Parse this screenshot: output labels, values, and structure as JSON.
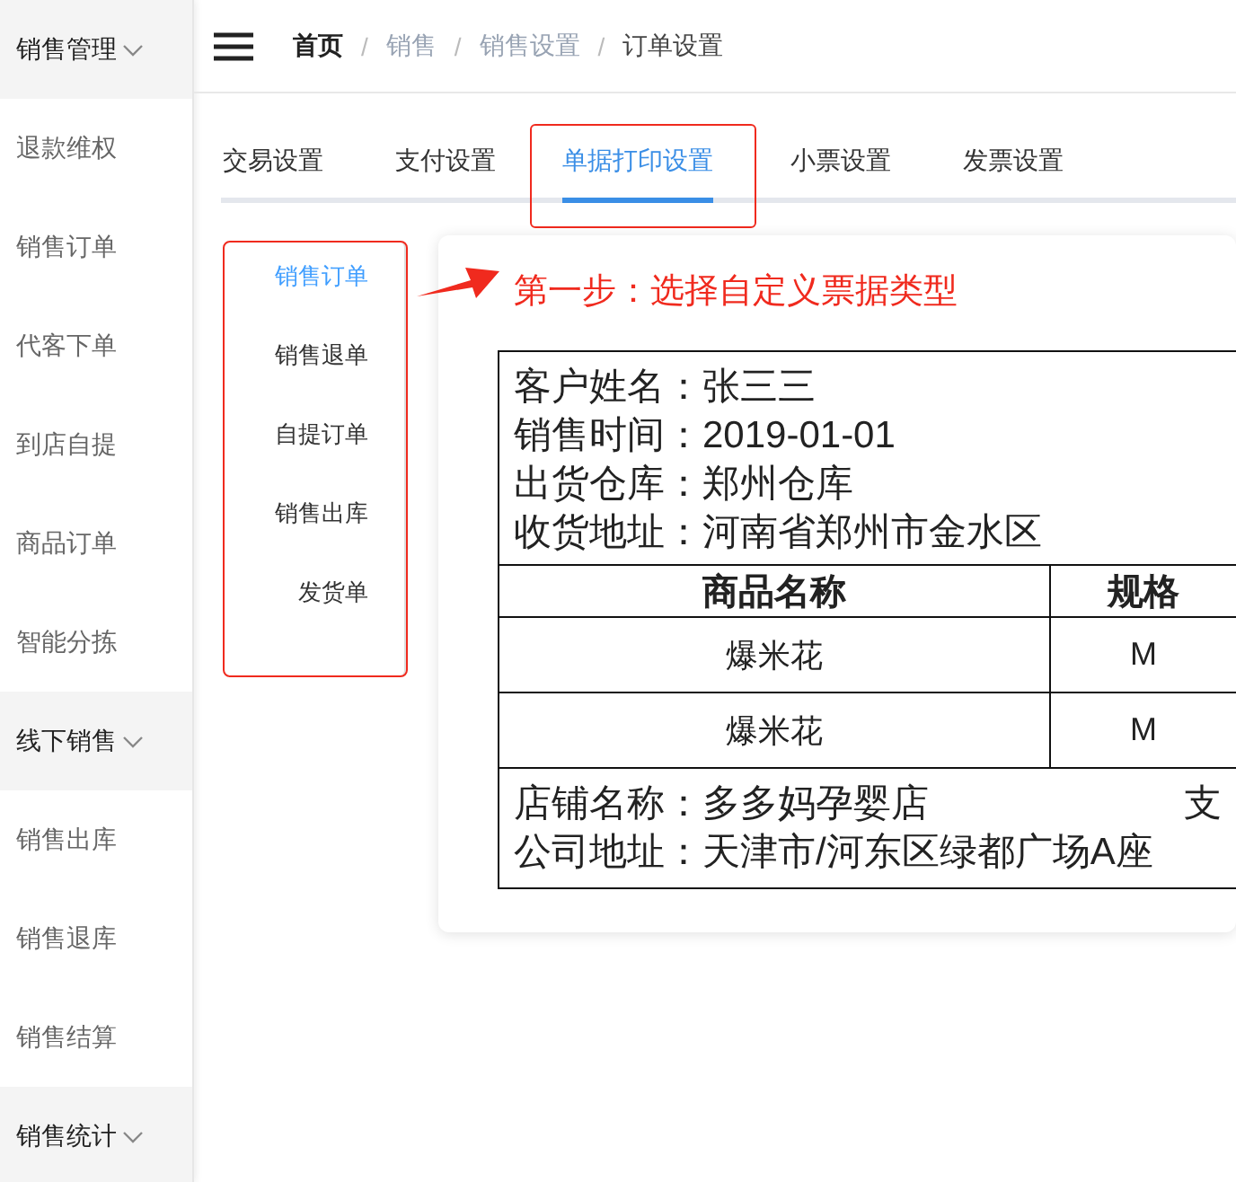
{
  "sidebar": {
    "groups": [
      {
        "title": "销售管理",
        "items": [
          "退款维权",
          "销售订单",
          "代客下单",
          "到店自提",
          "商品订单",
          "智能分拣"
        ]
      },
      {
        "title": "线下销售",
        "items": [
          "销售出库",
          "销售退库",
          "销售结算"
        ]
      },
      {
        "title": "销售统计"
      }
    ]
  },
  "breadcrumb_separator": "/",
  "breadcrumb": [
    {
      "label": "首页",
      "kind": "home"
    },
    {
      "label": "销售",
      "kind": "link"
    },
    {
      "label": "销售设置",
      "kind": "link"
    },
    {
      "label": "订单设置",
      "kind": "current"
    }
  ],
  "tabs": [
    {
      "label": "交易设置",
      "selected": false,
      "highlighted": false
    },
    {
      "label": "支付设置",
      "selected": false,
      "highlighted": false
    },
    {
      "label": "单据打印设置",
      "selected": true,
      "highlighted": true
    },
    {
      "label": "小票设置",
      "selected": false,
      "highlighted": false
    },
    {
      "label": "发票设置",
      "selected": false,
      "highlighted": false
    }
  ],
  "doc_types": {
    "highlighted": true,
    "items": [
      {
        "label": "销售订单",
        "selected": true
      },
      {
        "label": "销售退单",
        "selected": false
      },
      {
        "label": "自提订单",
        "selected": false
      },
      {
        "label": "销售出库",
        "selected": false
      },
      {
        "label": "发货单",
        "selected": false
      }
    ]
  },
  "step_note": "第一步：选择自定义票据类型",
  "receipt": {
    "header_lines": [
      "客户姓名：张三三",
      "销售时间：2019-01-01",
      "出货仓库：郑州仓库",
      "收货地址：河南省郑州市金水区"
    ],
    "columns": [
      "商品名称",
      "规格"
    ],
    "rows": [
      [
        "爆米花",
        "M"
      ],
      [
        "爆米花",
        "M"
      ]
    ],
    "footer_lines": [
      {
        "left": "店铺名称：多多妈孕婴店",
        "right": "支"
      },
      {
        "left": "公司地址：天津市/河东区绿都广场A座"
      }
    ]
  }
}
